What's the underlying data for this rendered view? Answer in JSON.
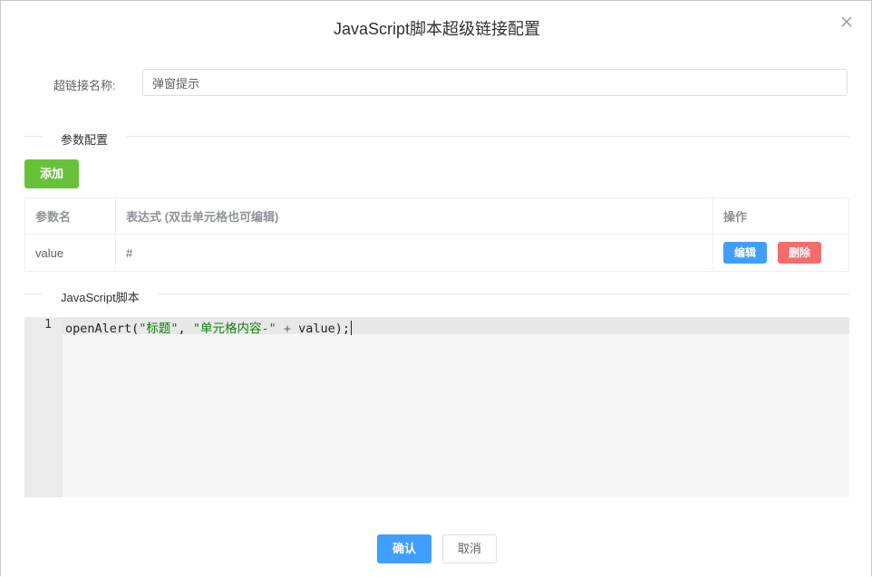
{
  "dialog": {
    "title": "JavaScript脚本超级链接配置"
  },
  "form": {
    "name_label": "超链接名称:",
    "name_value": "弹窗提示"
  },
  "params_section": {
    "title": "参数配置",
    "add_label": "添加",
    "columns": [
      "参数名",
      "表达式 (双击单元格也可编辑)",
      "操作"
    ],
    "rows": [
      {
        "name": "value",
        "expression": "#",
        "edit_label": "编辑",
        "delete_label": "删除"
      }
    ]
  },
  "script_section": {
    "title": "JavaScript脚本",
    "line_number": "1",
    "code": {
      "fn": "openAlert(",
      "str1": "\"标题\"",
      "sep": ", ",
      "str2": "\"单元格内容-\"",
      "plus": " + ",
      "rest": "value);"
    }
  },
  "footer": {
    "confirm_label": "确认",
    "cancel_label": "取消"
  },
  "colors": {
    "primary": "#409eff",
    "success": "#67c23a",
    "danger": "#f56c6c",
    "string": "#108010"
  },
  "icons": {
    "close": "close-icon"
  }
}
